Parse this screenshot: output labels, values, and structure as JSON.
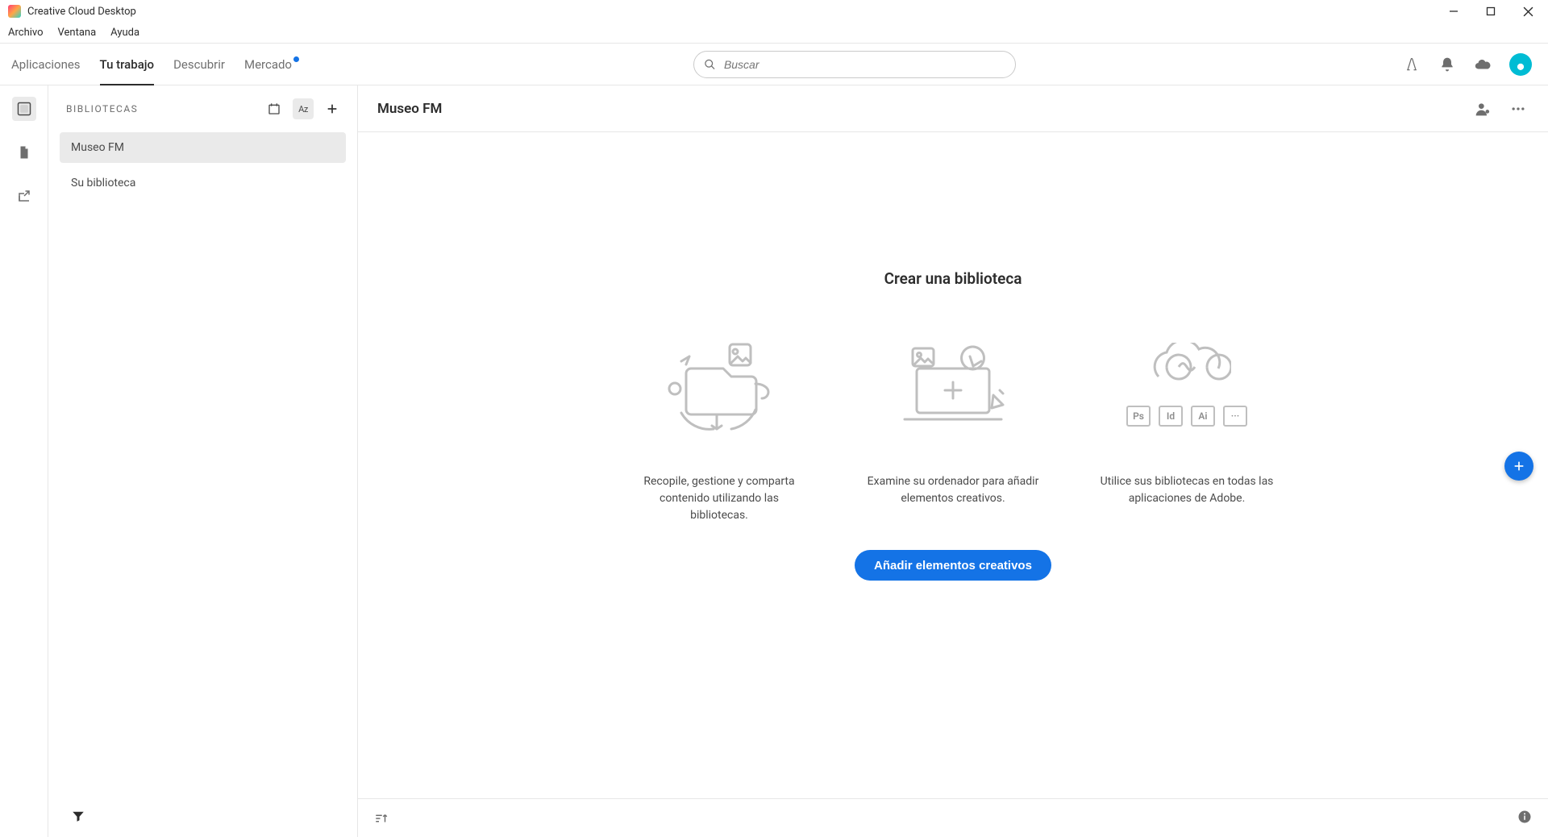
{
  "window": {
    "title": "Creative Cloud Desktop"
  },
  "menubar": {
    "items": [
      "Archivo",
      "Ventana",
      "Ayuda"
    ]
  },
  "primary_tabs": {
    "items": [
      {
        "label": "Aplicaciones",
        "active": false,
        "badge": false
      },
      {
        "label": "Tu trabajo",
        "active": true,
        "badge": false
      },
      {
        "label": "Descubrir",
        "active": false,
        "badge": false
      },
      {
        "label": "Mercado",
        "active": false,
        "badge": true
      }
    ]
  },
  "search": {
    "placeholder": "Buscar"
  },
  "sidebar": {
    "title": "BIBLIOTECAS",
    "sort_az": "Az",
    "items": [
      {
        "label": "Museo FM",
        "selected": true
      },
      {
        "label": "Su biblioteca",
        "selected": false
      }
    ]
  },
  "main": {
    "title": "Museo FM",
    "empty_title": "Crear una biblioteca",
    "cards": [
      {
        "text": "Recopile, gestione y comparta contenido utilizando las bibliotecas."
      },
      {
        "text": "Examine su ordenador para añadir elementos creativos."
      },
      {
        "text": "Utilice sus bibliotecas en todas las aplicaciones de Adobe."
      }
    ],
    "cta": "Añadir elementos creativos",
    "app_chips": [
      "Ps",
      "Id",
      "Ai",
      "···"
    ]
  }
}
